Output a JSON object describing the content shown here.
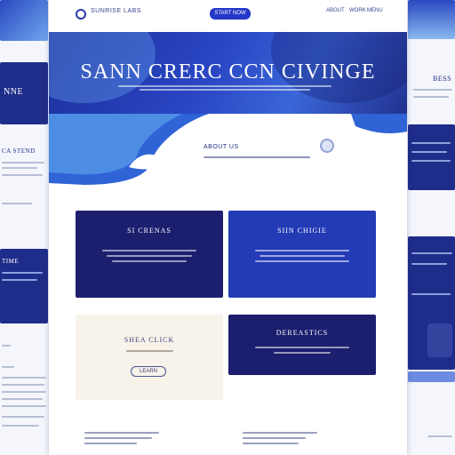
{
  "nav": {
    "brand": "SUNRISE LABS",
    "cta_label": "START NOW",
    "links": [
      "ABOUT",
      "WORK",
      "MENU"
    ]
  },
  "hero": {
    "title": "SANN CRERC CCN CIVINGE"
  },
  "intro": {
    "title": "ABOUT US"
  },
  "cards": [
    {
      "title": "SI CRENAS",
      "style": "dark-navy"
    },
    {
      "title": "SIIN CHIGIE",
      "style": "royal-blue"
    },
    {
      "title": "SHEA CLICK",
      "style": "cream",
      "button_label": "LEARN"
    },
    {
      "title": "DEREASTICS",
      "style": "dark-navy"
    }
  ],
  "side_left": {
    "caption_a": "NNE",
    "caption_b": "CA STEND",
    "caption_c": "TIME"
  },
  "side_right": {
    "caption_a": "BESS"
  },
  "colors": {
    "primary": "#1f2f9c",
    "navy": "#1c1e6e",
    "royal": "#233bb5",
    "cream": "#f7f2ea",
    "accent": "#2438c8"
  }
}
